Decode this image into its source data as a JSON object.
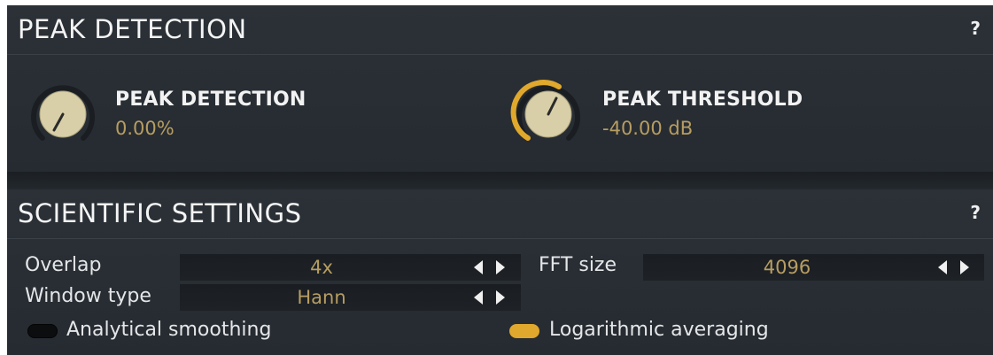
{
  "peak_section": {
    "title": "PEAK DETECTION",
    "help": "?",
    "knobs": [
      {
        "label": "PEAK DETECTION",
        "value": "0.00%",
        "level": 0.0,
        "icon": "knob-icon"
      },
      {
        "label": "PEAK THRESHOLD",
        "value": "-40.00 dB",
        "level": 0.6,
        "icon": "knob-icon"
      }
    ]
  },
  "scientific_section": {
    "title": "SCIENTIFIC SETTINGS",
    "help": "?",
    "selectors": {
      "overlap": {
        "label": "Overlap",
        "value": "4x"
      },
      "fft_size": {
        "label": "FFT size",
        "value": "4096"
      },
      "window_type": {
        "label": "Window type",
        "value": "Hann"
      }
    },
    "toggles": {
      "analytical_smoothing": {
        "label": "Analytical smoothing",
        "on": false
      },
      "logarithmic_averaging": {
        "label": "Logarithmic averaging",
        "on": true
      }
    }
  },
  "colors": {
    "accent": "#e0a82c",
    "value_text": "#b79d61",
    "panel_bg": "#2b3137",
    "selector_bg": "#1a1e22"
  }
}
